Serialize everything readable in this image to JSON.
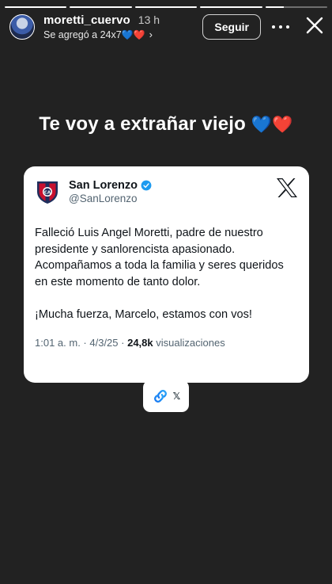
{
  "story": {
    "progress": [
      1,
      1,
      1,
      1,
      0.3
    ]
  },
  "header": {
    "username": "moretti_cuervo",
    "time": "13 h",
    "subtitle_prefix": "Se agregó a 24x7",
    "subtitle_hearts": [
      "💙",
      "❤️"
    ],
    "follow_label": "Seguir"
  },
  "caption": {
    "text": "Te voy a extrañar viejo",
    "hearts": [
      "💙",
      "❤️"
    ]
  },
  "tweet": {
    "name": "San Lorenzo",
    "handle": "@SanLorenzo",
    "body": "Falleció Luis Angel Moretti, padre de nuestro presidente y sanlorencista apasionado. Acompañamos a toda la familia y seres queridos en este momento de tanto dolor.\n\n¡Mucha fuerza, Marcelo, estamos con vos!",
    "time": "1:01 a. m.",
    "date": "4/3/25",
    "views_count": "24,8k",
    "views_label": "visualizaciones"
  },
  "link_sticker": {
    "label": "𝕏"
  },
  "colors": {
    "story_bg": "#222222",
    "x_blue": "#1d9bf0",
    "club_red": "#c8102e",
    "club_navy": "#1f2e5c"
  },
  "icons": [
    "avatar",
    "chevron-right-icon",
    "more-icon",
    "close-icon",
    "club-crest-icon",
    "verified-icon",
    "x-logo-icon",
    "link-icon"
  ]
}
